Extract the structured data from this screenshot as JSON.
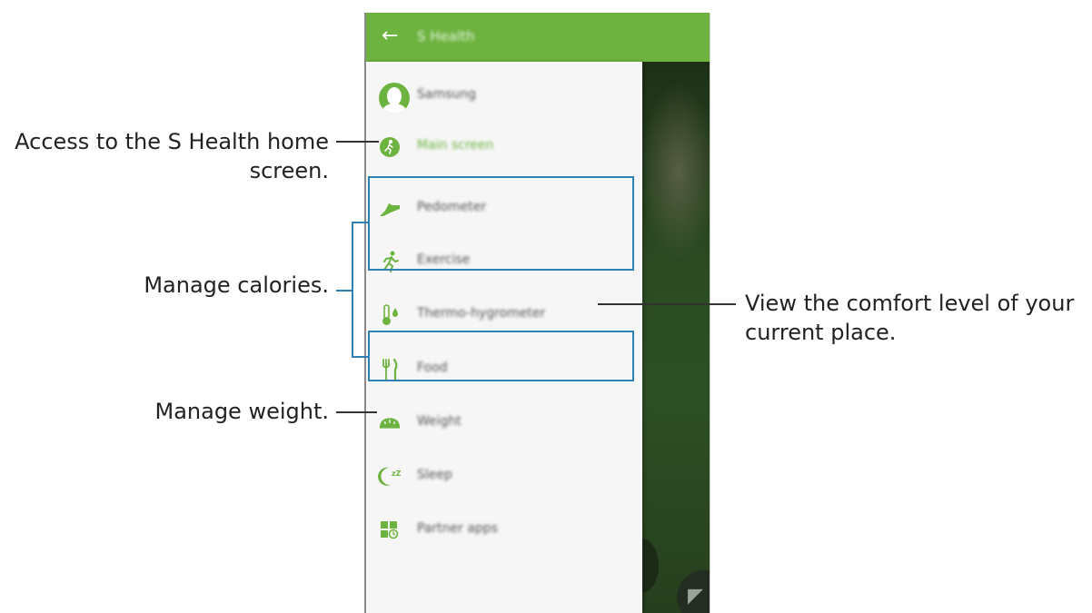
{
  "app_bar": {
    "back_glyph": "←",
    "title": "S Health"
  },
  "profile": {
    "name": "Samsung"
  },
  "menu": [
    {
      "key": "main",
      "label": "Main screen",
      "icon": "runner-circle-icon",
      "active": true
    },
    {
      "key": "pedometer",
      "label": "Pedometer",
      "icon": "shoe-icon"
    },
    {
      "key": "exercise",
      "label": "Exercise",
      "icon": "running-figure-icon"
    },
    {
      "key": "thermo",
      "label": "Thermo-hygrometer",
      "icon": "thermometer-icon"
    },
    {
      "key": "food",
      "label": "Food",
      "icon": "fork-knife-icon"
    },
    {
      "key": "weight",
      "label": "Weight",
      "icon": "scale-icon"
    },
    {
      "key": "sleep",
      "label": "Sleep",
      "icon": "moon-icon"
    },
    {
      "key": "partner",
      "label": "Partner apps",
      "icon": "apps-grid-icon"
    }
  ],
  "callouts": {
    "main_line1": "Access to the S Health home",
    "main_line2": "screen.",
    "calories": "Manage calories.",
    "weight": "Manage weight.",
    "comfort_line1": "View the comfort level of your",
    "comfort_line2": "current place."
  },
  "colors": {
    "accent": "#6db33f",
    "callout_box": "#2f7fb3"
  }
}
